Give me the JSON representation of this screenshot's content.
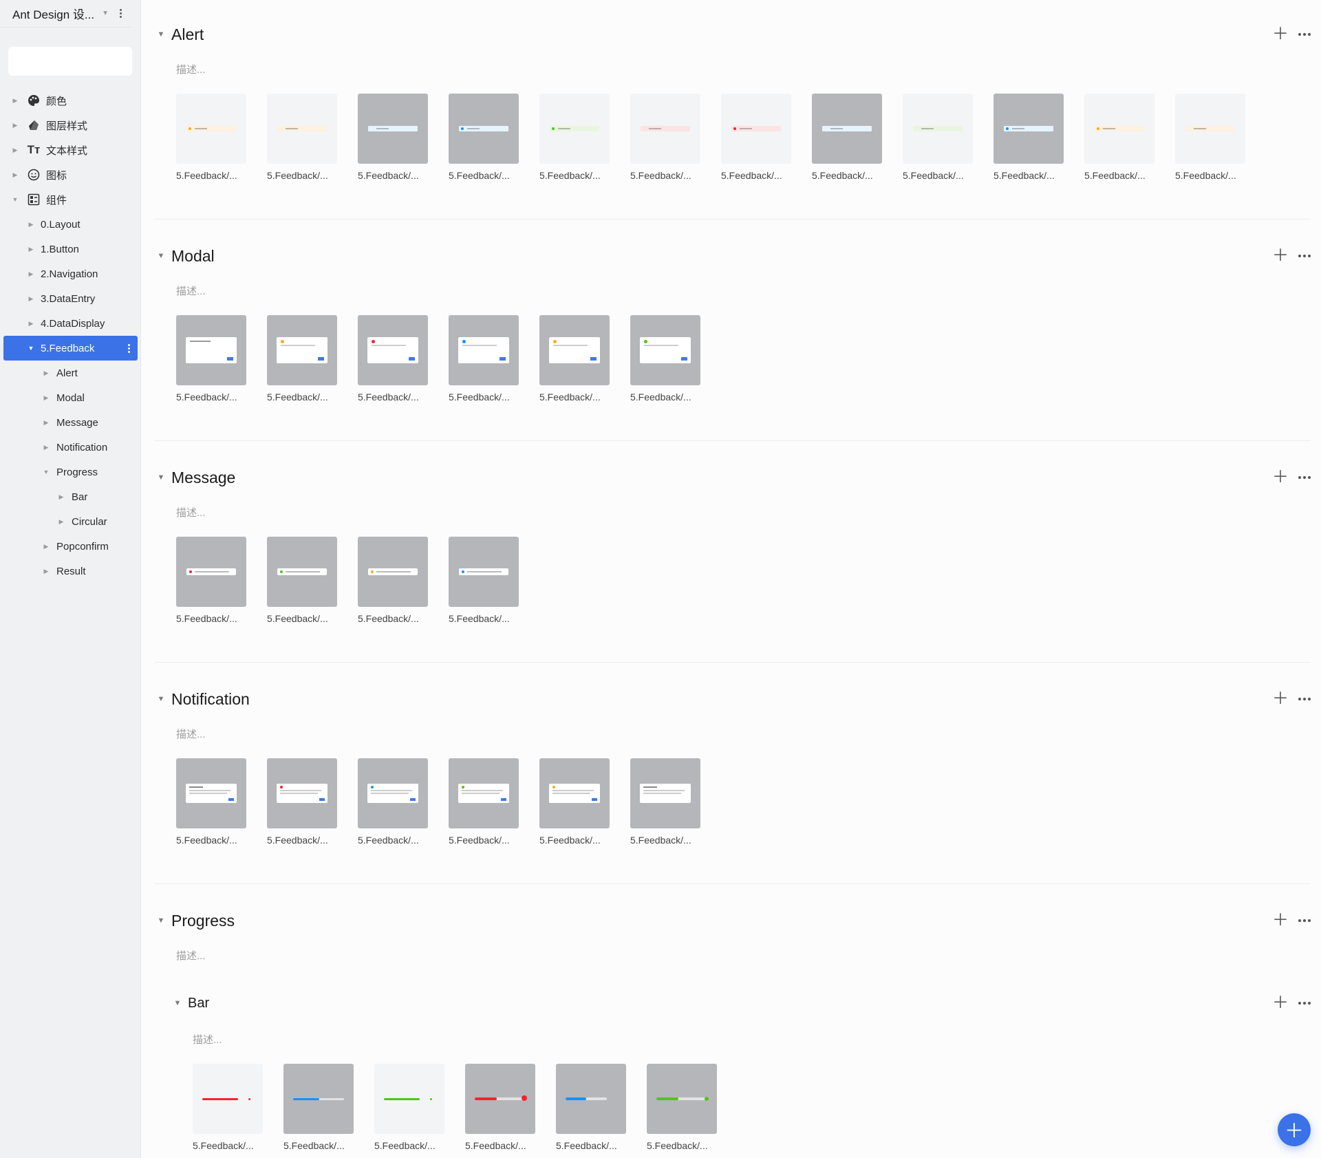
{
  "sidebar": {
    "title": "Ant Design 设...",
    "search_placeholder": "",
    "items": [
      {
        "label": "颜色",
        "icon": "palette-icon"
      },
      {
        "label": "图层样式",
        "icon": "layer-style-icon"
      },
      {
        "label": "文本样式",
        "icon": "text-style-icon"
      },
      {
        "label": "图标",
        "icon": "smiley-icon"
      },
      {
        "label": "组件",
        "icon": "components-icon"
      }
    ],
    "components": [
      "0.Layout",
      "1.Button",
      "2.Navigation",
      "3.DataEntry",
      "4.DataDisplay",
      "5.Feedback"
    ],
    "feedback_children": [
      "Alert",
      "Modal",
      "Message",
      "Notification",
      "Progress",
      "Popconfirm",
      "Result"
    ],
    "progress_children": [
      "Bar",
      "Circular"
    ]
  },
  "sections": {
    "alert": {
      "title": "Alert",
      "desc": "描述...",
      "count": 12
    },
    "modal": {
      "title": "Modal",
      "desc": "描述...",
      "count": 6
    },
    "message": {
      "title": "Message",
      "desc": "描述...",
      "count": 4
    },
    "notification": {
      "title": "Notification",
      "desc": "描述...",
      "count": 6
    },
    "progress": {
      "title": "Progress",
      "desc": "描述..."
    },
    "bar": {
      "title": "Bar",
      "desc": "描述...",
      "count": 6
    }
  },
  "thumb_caption": "5.Feedback/...",
  "colors": {
    "accent": "#3b72e8",
    "warning": "#faad14",
    "info": "#1890ff",
    "success": "#52c41a",
    "error": "#f5222d"
  }
}
